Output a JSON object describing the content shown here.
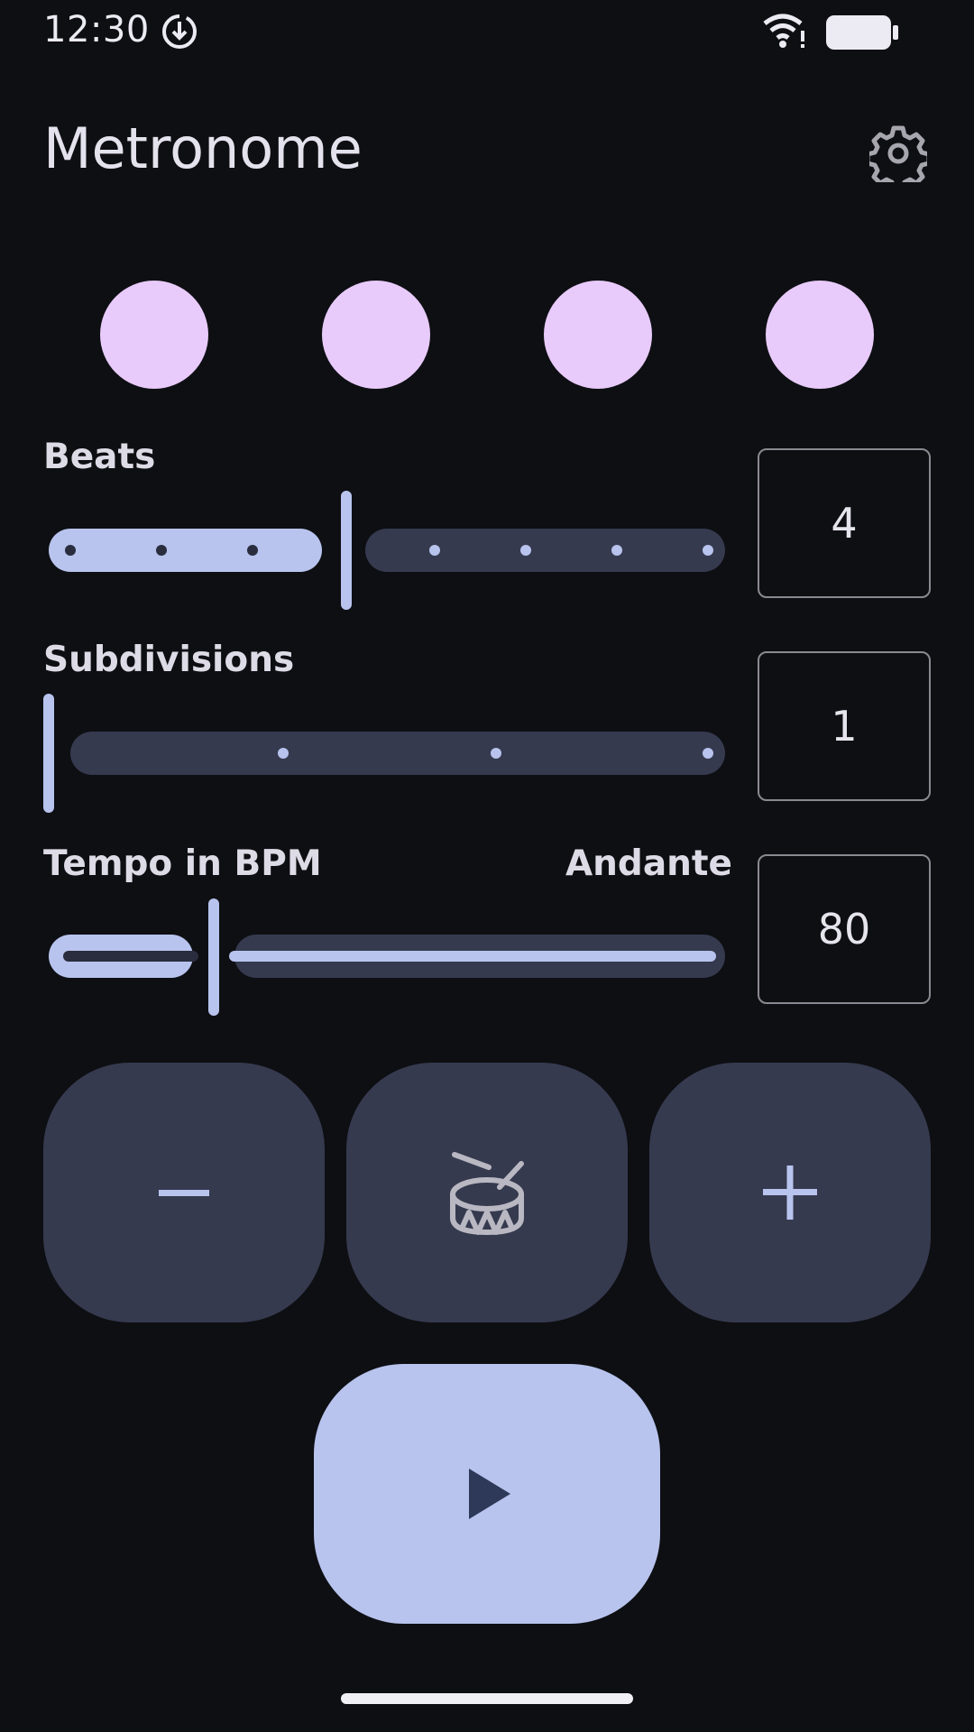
{
  "status_bar": {
    "time": "12:30",
    "icons": [
      "download-icon",
      "wifi-icon",
      "battery-icon"
    ]
  },
  "app": {
    "title": "Metronome",
    "settings_icon": "gear-icon"
  },
  "beat_indicators": {
    "count": 4,
    "color": "#e8cbfa"
  },
  "beats": {
    "label": "Beats",
    "value": "4",
    "slider": {
      "min": 1,
      "max": 8,
      "value": 4
    }
  },
  "subdivisions": {
    "label": "Subdivisions",
    "value": "1",
    "slider": {
      "min": 1,
      "max": 4,
      "value": 1
    }
  },
  "tempo": {
    "label": "Tempo in BPM",
    "marking": "Andante",
    "value": "80",
    "slider": {
      "fraction": 0.24
    }
  },
  "controls": {
    "decrement_icon": "minus-icon",
    "tap_icon": "drum-icon",
    "increment_icon": "plus-icon",
    "play_icon": "play-icon"
  },
  "colors": {
    "background": "#0e0f13",
    "accent": "#b8c4ee",
    "surface": "#363a4f",
    "beat": "#e8cbfa"
  }
}
